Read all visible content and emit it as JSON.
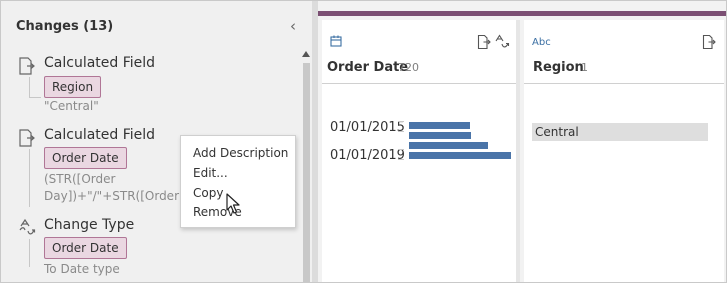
{
  "changes_panel": {
    "title": "Changes (13)",
    "collapse_icon": "chevron-left-icon",
    "items": [
      {
        "icon": "calculated-field-icon",
        "title": "Calculated Field",
        "field": "Region",
        "detail_lines": [
          "\"Central\""
        ]
      },
      {
        "icon": "calculated-field-icon",
        "title": "Calculated Field",
        "field": "Order Date",
        "detail_lines": [
          "(STR([Order",
          "Day])+\"/\"+STR([Order"
        ]
      },
      {
        "icon": "change-type-icon",
        "title": "Change Type",
        "field": "Order Date",
        "detail_lines": [
          "To Date type"
        ]
      }
    ]
  },
  "context_menu": {
    "items": [
      "Add Description",
      "Edit...",
      "Copy",
      "Remove"
    ]
  },
  "profile": {
    "accent_color": "#7b4f73",
    "bar_color": "#4a74a8",
    "cards": [
      {
        "type_icon": "calendar-icon",
        "name": "Order Date",
        "count": "720",
        "icons": [
          "calculated-field-icon",
          "change-type-icon"
        ],
        "axis_labels": [
          "01/01/2015",
          "01/01/2019"
        ]
      },
      {
        "type_label": "Abc",
        "type_icon": "string-type-icon",
        "name": "Region",
        "count": "1",
        "icons": [
          "calculated-field-icon"
        ],
        "values": [
          "Central"
        ]
      }
    ]
  }
}
